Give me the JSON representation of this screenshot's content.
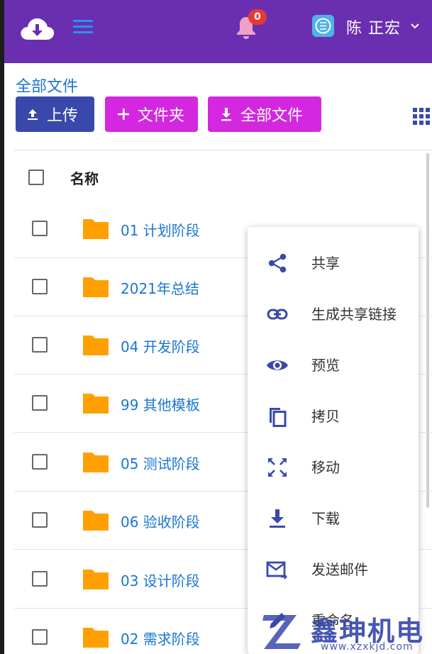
{
  "header": {
    "notification_count": "0",
    "user_name": "陈 正宏"
  },
  "breadcrumb": "全部文件",
  "toolbar": {
    "upload_label": "上传",
    "new_folder_label": "文件夹",
    "download_all_label": "全部文件"
  },
  "table": {
    "column_name": "名称",
    "rows": [
      {
        "name": "01 计划阶段"
      },
      {
        "name": "2021年总结"
      },
      {
        "name": "04 开发阶段"
      },
      {
        "name": "99 其他模板"
      },
      {
        "name": "05 测试阶段"
      },
      {
        "name": "06 验收阶段"
      },
      {
        "name": "03 设计阶段"
      },
      {
        "name": "02 需求阶段"
      }
    ]
  },
  "context_menu": {
    "items": [
      {
        "label": "共享",
        "icon": "share-icon"
      },
      {
        "label": "生成共享链接",
        "icon": "link-icon"
      },
      {
        "label": "预览",
        "icon": "eye-icon"
      },
      {
        "label": "拷贝",
        "icon": "copy-icon"
      },
      {
        "label": "移动",
        "icon": "move-icon"
      },
      {
        "label": "下载",
        "icon": "download-icon"
      },
      {
        "label": "发送邮件",
        "icon": "email-icon"
      },
      {
        "label": "重命名",
        "icon": "rename-icon"
      }
    ]
  },
  "watermark": {
    "brand": "鑫珅机电",
    "url": "www.xzxkjd.com"
  },
  "colors": {
    "header_bg": "#6a2fb0",
    "primary": "#3949ab",
    "accent": "#d427e0",
    "link": "#1976d2",
    "folder": "#ffa000",
    "badge": "#e53935"
  }
}
